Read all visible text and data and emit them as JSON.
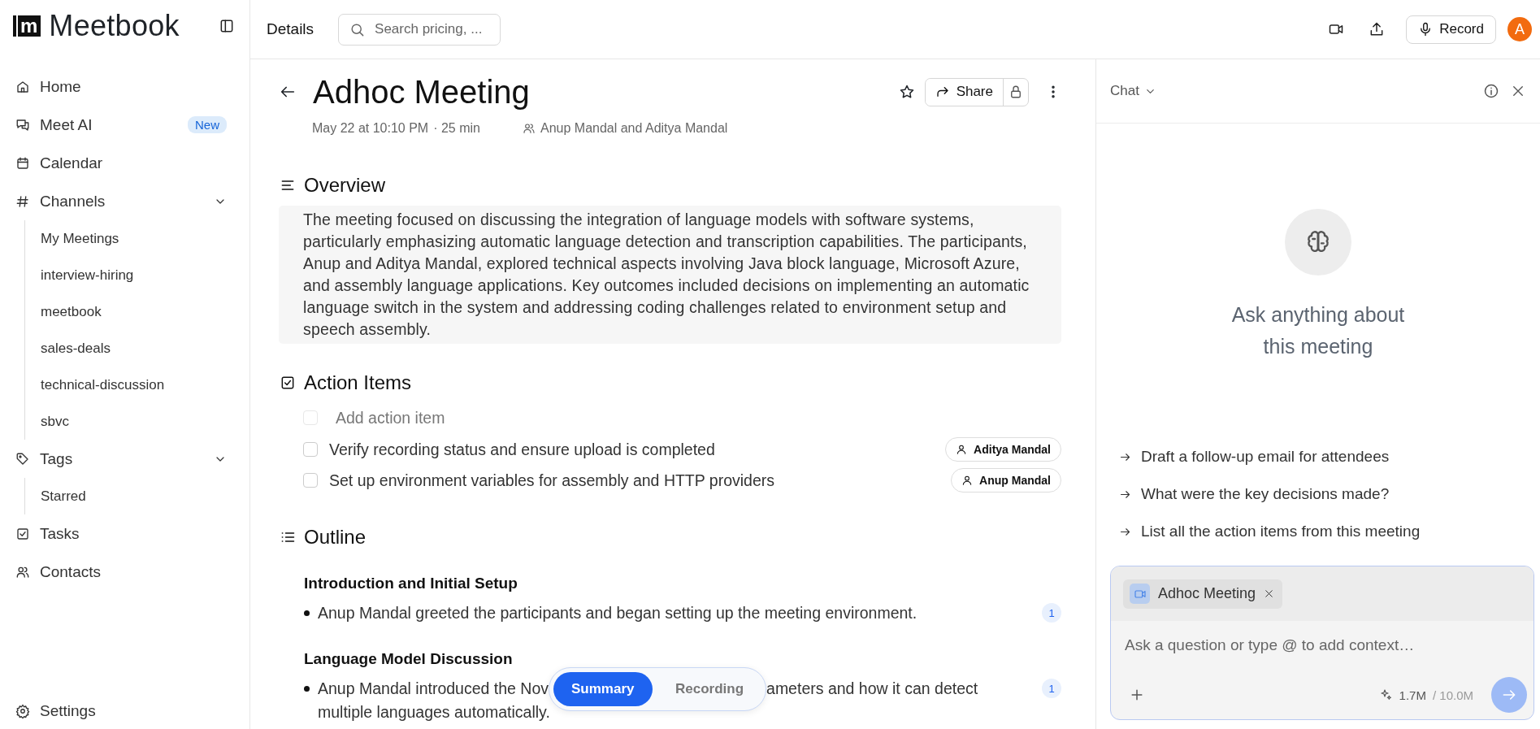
{
  "brand": {
    "mark": "m",
    "name": "Meetbook"
  },
  "sidebar": {
    "items": [
      {
        "label": "Home"
      },
      {
        "label": "Meet AI",
        "badge": "New"
      },
      {
        "label": "Calendar"
      },
      {
        "label": "Channels",
        "expanded": true,
        "children": [
          {
            "label": "My Meetings"
          },
          {
            "label": "interview-hiring"
          },
          {
            "label": "meetbook"
          },
          {
            "label": "sales-deals"
          },
          {
            "label": "technical-discussion"
          },
          {
            "label": "sbvc"
          }
        ]
      },
      {
        "label": "Tags",
        "expanded": true,
        "children": [
          {
            "label": "Starred"
          }
        ]
      },
      {
        "label": "Tasks"
      },
      {
        "label": "Contacts"
      }
    ],
    "footer": {
      "label": "Settings"
    }
  },
  "header": {
    "title": "Details",
    "search": {
      "placeholder": "Search pricing, ..."
    },
    "record_button": "Record",
    "avatar": "A"
  },
  "meeting": {
    "title": "Adhoc Meeting",
    "starred": false,
    "share_button": "Share",
    "date": "May 22 at 10:10 PM",
    "duration": "· 25 min",
    "attendees": "Anup Mandal and Aditya Mandal",
    "overview": {
      "heading": "Overview",
      "text": "The meeting focused on discussing the integration of language models with software systems, particularly emphasizing automatic language detection and transcription capabilities. The participants, Anup and Aditya Mandal, explored technical aspects involving Java block language, Microsoft Azure, and assembly language applications. Key outcomes included decisions on implementing an automatic language switch in the system and addressing coding challenges related to environment setup and speech assembly."
    },
    "action_items": {
      "heading": "Action Items",
      "add_row": {
        "placeholder": "Add action item",
        "checked": false
      },
      "items": [
        {
          "text": "Verify recording status and ensure upload is completed",
          "checked": false,
          "assignee": "Aditya Mandal"
        },
        {
          "text": "Set up environment variables for assembly and HTTP providers",
          "checked": false,
          "assignee": "Anup Mandal"
        }
      ]
    },
    "outline": {
      "heading": "Outline",
      "topics": [
        {
          "title": "Introduction and Initial Setup",
          "points": [
            {
              "segments": [
                "Anup Mandal greeted the participants and began setting up the meeting environment."
              ],
              "count": "1"
            }
          ]
        },
        {
          "title": "Language Model Discussion",
          "points": [
            {
              "segments": [
                "Anup Mandal introduced the Nov",
                "ameters and how it can detect",
                "multiple languages automatically."
              ],
              "count": "1"
            }
          ]
        }
      ]
    }
  },
  "view_toggle": [
    {
      "label": "Summary",
      "selected": true
    },
    {
      "label": "Recording",
      "selected": false
    }
  ],
  "chat": {
    "title": "Chat",
    "prompt": "Ask anything about this meeting",
    "suggestions": [
      "Draft a follow-up email for attendees",
      "What were the key decisions made?",
      "List all the action items from this meeting"
    ],
    "context_chip": "Adhoc Meeting",
    "placeholder": "Ask a question or type @ to add context…",
    "usage": "1.7M",
    "limit": "/ 10.0M"
  }
}
